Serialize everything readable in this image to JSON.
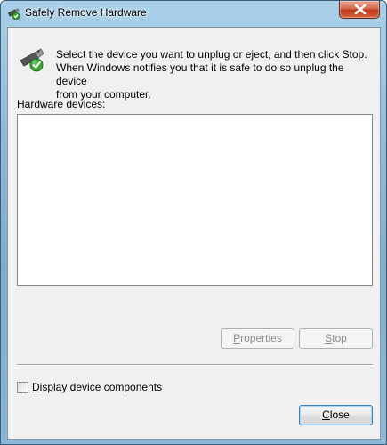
{
  "window": {
    "title": "Safely Remove Hardware"
  },
  "dialog": {
    "instruction_line1": "Select the device you want to unplug or eject, and then click Stop.",
    "instruction_line2": "When Windows notifies you that it is safe to do so unplug the device",
    "instruction_line3": "from your computer.",
    "devices_label_mnemonic": "H",
    "devices_label_rest": "ardware devices:",
    "hardware_devices": []
  },
  "buttons": {
    "properties_mnemonic": "P",
    "properties_rest": "roperties",
    "stop_mnemonic": "S",
    "stop_rest": "top",
    "close_mnemonic": "C",
    "close_rest": "lose"
  },
  "options": {
    "display_components_mnemonic": "D",
    "display_components_rest": "isplay device components",
    "display_components_checked": false
  },
  "colors": {
    "close_button_red": "#c2391a",
    "dialog_background": "#f0f0f0",
    "default_button_border": "#3c7fb1"
  },
  "icons": {
    "title": "usb-plug-check-icon",
    "header": "usb-plug-check-icon",
    "close": "close-x-icon"
  }
}
